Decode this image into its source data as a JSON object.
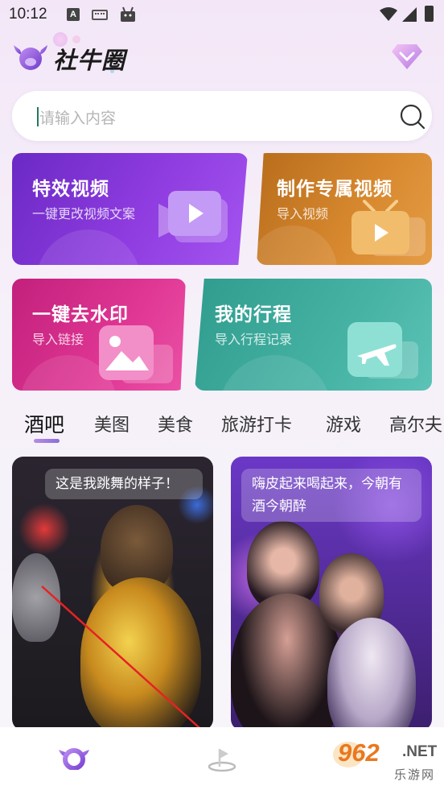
{
  "status_bar": {
    "time": "10:12",
    "a_icon": "A"
  },
  "header": {
    "app_title": "社牛圈"
  },
  "search": {
    "placeholder": "请输入内容"
  },
  "cards": [
    {
      "title": "特效视频",
      "subtitle": "一键更改视频文案"
    },
    {
      "title": "制作专属视频",
      "subtitle": "导入视频"
    },
    {
      "title": "一键去水印",
      "subtitle": "导入链接"
    },
    {
      "title": "我的行程",
      "subtitle": "导入行程记录"
    }
  ],
  "tabs": [
    "酒吧",
    "美图",
    "美食",
    "旅游打卡",
    "游戏",
    "高尔夫"
  ],
  "feed": [
    {
      "caption": "这是我跳舞的样子！"
    },
    {
      "caption": "嗨皮起来喝起来，今朝有酒今朝醉"
    }
  ],
  "watermark": {
    "number": "962",
    "net": ".NET",
    "site": "乐游网"
  },
  "colors": {
    "accent": "#8a4fe0",
    "card1": "#7b32d4",
    "card2": "#d98a30",
    "card3": "#e03694",
    "card4": "#45b2a4",
    "arrow": "#e52323"
  }
}
